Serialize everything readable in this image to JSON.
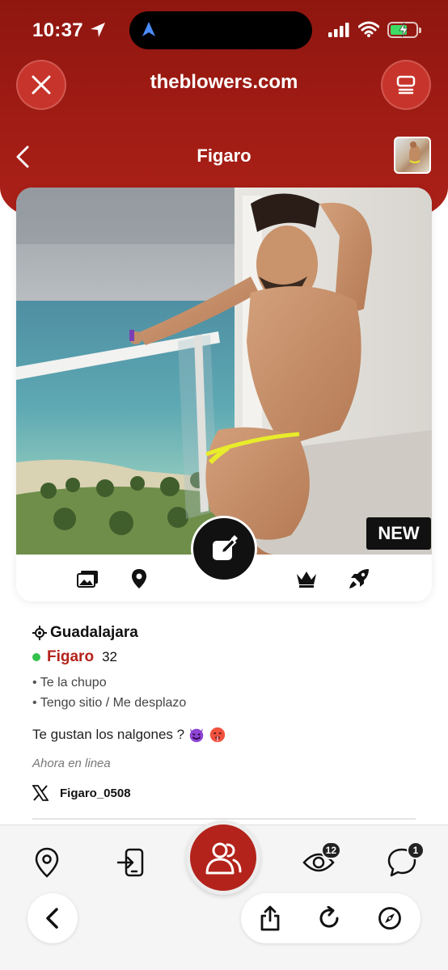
{
  "status_bar": {
    "time": "10:37"
  },
  "browser": {
    "url": "theblowers.com"
  },
  "nav": {
    "title": "Figaro"
  },
  "card": {
    "badge": "NEW"
  },
  "profile": {
    "city": "Guadalajara",
    "name": "Figaro",
    "age": "32",
    "tags": [
      "Te la chupo",
      "Tengo sitio / Me desplazo"
    ],
    "bio": "Te gustan los nalgones ?",
    "online_status": "Ahora en linea",
    "twitter_handle": "Figaro_0508"
  },
  "bottom_nav": {
    "views_badge": "12",
    "messages_badge": "1"
  },
  "colors": {
    "brand_red": "#b3231b",
    "header_red": "#9c1b13",
    "online_green": "#33c24d"
  }
}
